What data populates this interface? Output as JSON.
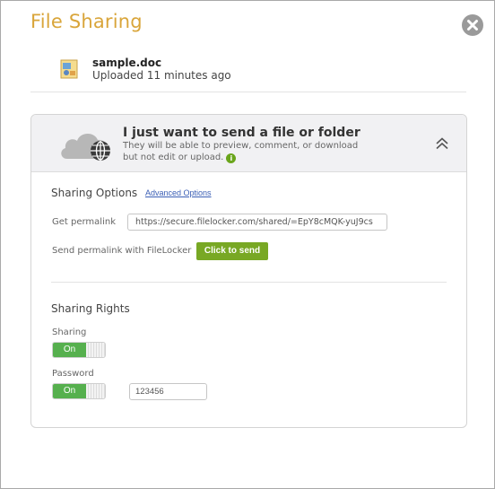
{
  "dialog": {
    "title": "File Sharing",
    "close_icon": "close-icon"
  },
  "file": {
    "name": "sample.doc",
    "meta": "Uploaded 11 minutes ago",
    "icon": "document-icon"
  },
  "panel": {
    "title": "I just want to send a file or folder",
    "description": "They will be able to preview, comment, or download but not edit or upload.",
    "info_icon": "i",
    "collapse_icon": "chevron-up-icon"
  },
  "sharing_options": {
    "title": "Sharing Options",
    "advanced_link": "Advanced Options",
    "permalink_label": "Get permalink",
    "permalink_value": "https://secure.filelocker.com/shared/=EpY8cMQK-yuJ9cs",
    "send_label": "Send permalink with FileLocker",
    "send_button": "Click to send"
  },
  "sharing_rights": {
    "title": "Sharing Rights",
    "sharing_label": "Sharing",
    "sharing_state": "On",
    "password_label": "Password",
    "password_state": "On",
    "password_value": "123456"
  },
  "colors": {
    "title_accent": "#d9a53a",
    "toggle_on": "#56b04e",
    "send_button": "#78a824",
    "link": "#3b5fb5"
  }
}
